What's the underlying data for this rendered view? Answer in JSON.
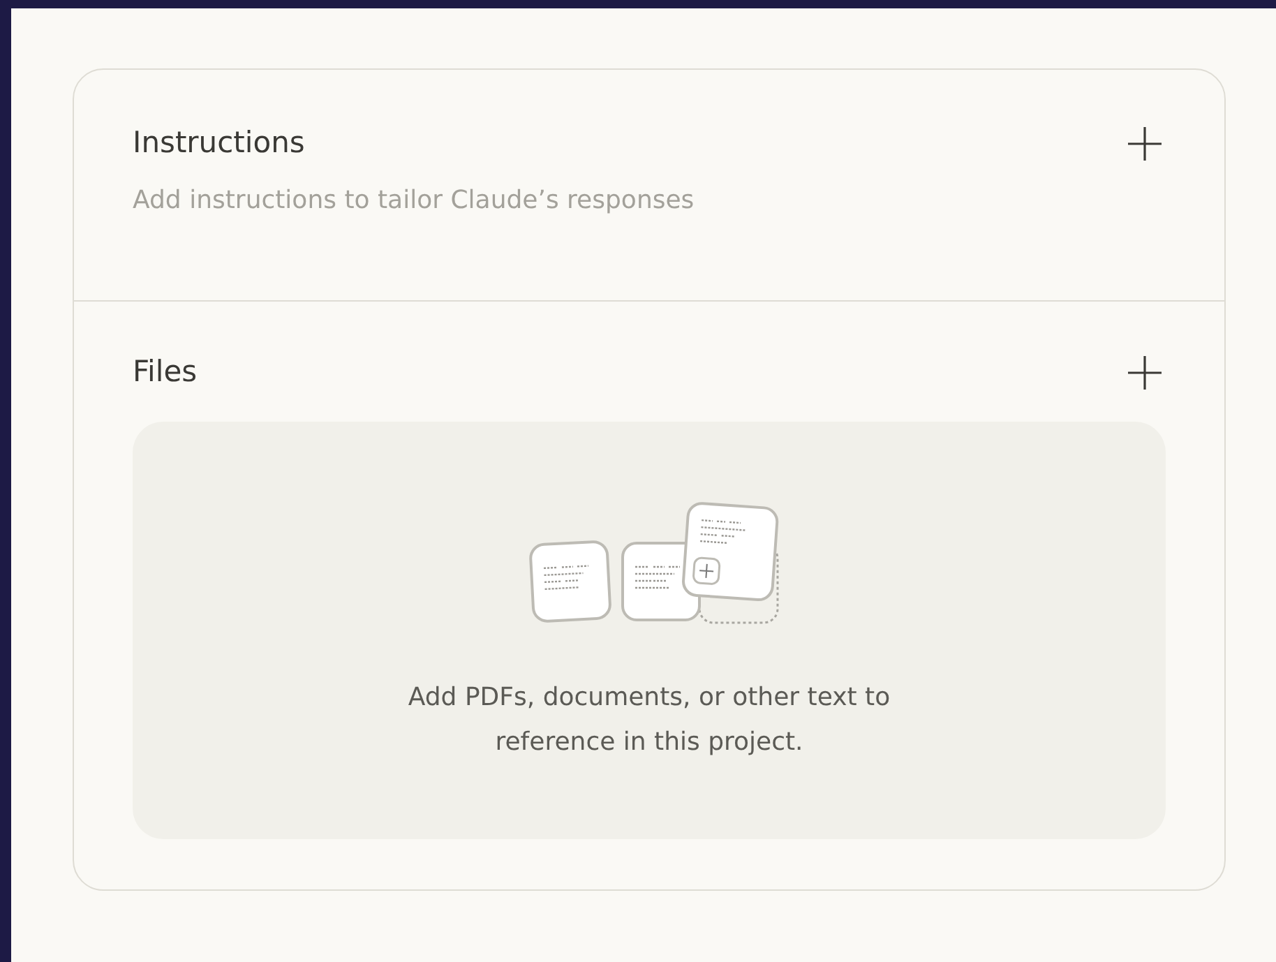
{
  "instructions": {
    "title": "Instructions",
    "subtitle": "Add instructions to tailor Claude’s responses"
  },
  "files": {
    "title": "Files",
    "empty_text": "Add PDFs, documents, or other text to reference in this project."
  }
}
